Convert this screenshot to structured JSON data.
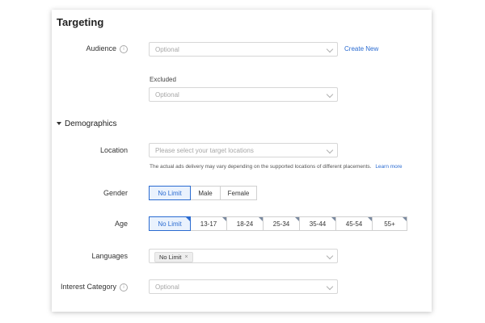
{
  "section_title": "Targeting",
  "audience": {
    "label": "Audience",
    "placeholder": "Optional",
    "create_new": "Create New",
    "excluded_label": "Excluded",
    "excluded_placeholder": "Optional"
  },
  "demographics": {
    "title": "Demographics",
    "location": {
      "label": "Location",
      "placeholder": "Please select your target locations",
      "note": "The actual ads delivery may vary depending on the supported locations of different placements.",
      "learn_more": "Learn more"
    },
    "gender": {
      "label": "Gender",
      "options": [
        "No Limit",
        "Male",
        "Female"
      ],
      "selected": "No Limit"
    },
    "age": {
      "label": "Age",
      "options": [
        "No Limit",
        "13-17",
        "18-24",
        "25-34",
        "35-44",
        "45-54",
        "55+"
      ],
      "selected": "No Limit"
    },
    "languages": {
      "label": "Languages",
      "tag": "No Limit",
      "tag_remove": "×"
    },
    "interest": {
      "label": "Interest Category",
      "placeholder": "Optional"
    }
  },
  "icons": {
    "info": "info-icon",
    "chevron": "chevron-down-icon",
    "caret": "caret-down-icon"
  },
  "colors": {
    "accent": "#2a6bd1",
    "selected_bg": "#eaf2fd"
  }
}
